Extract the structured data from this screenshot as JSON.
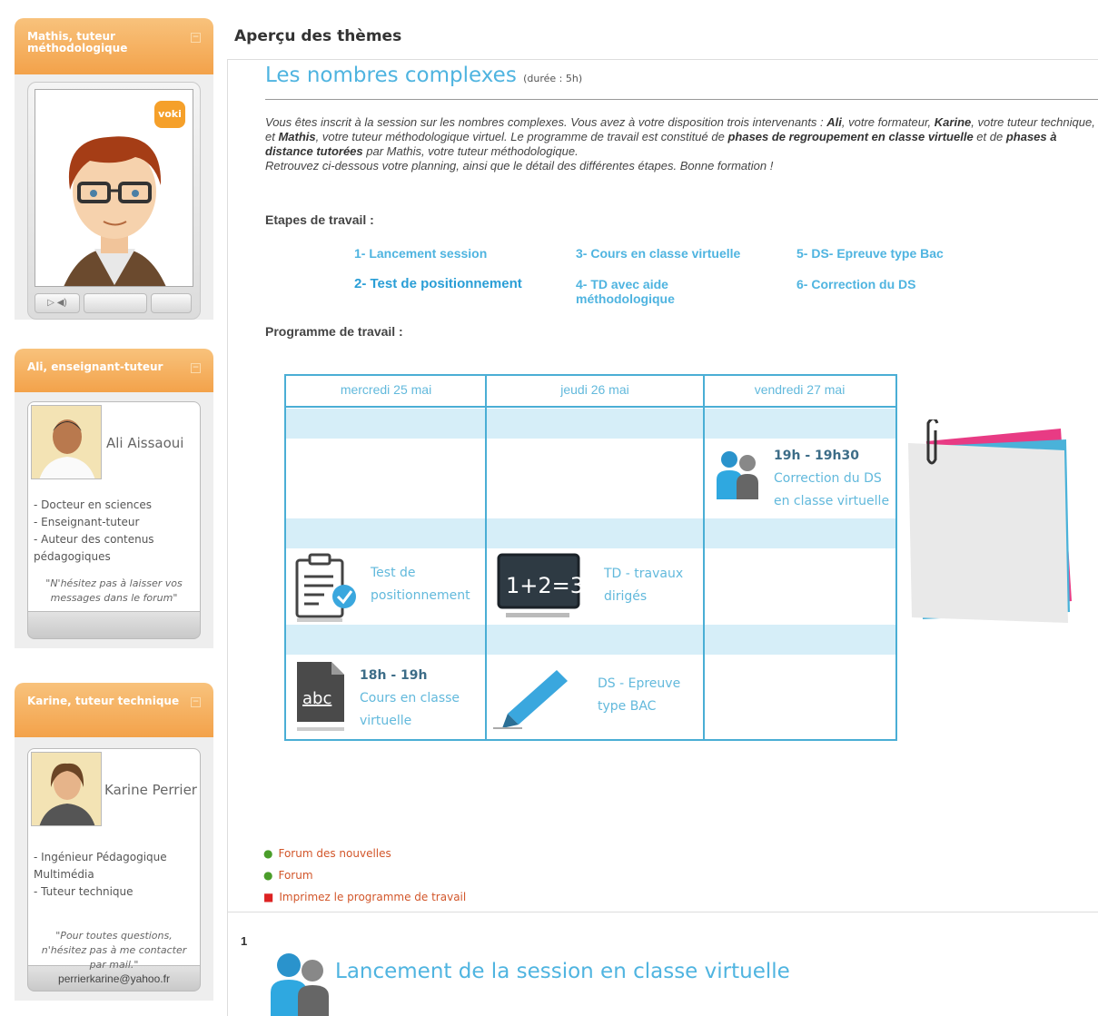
{
  "sidebar": {
    "mathis": {
      "title": "Mathis, tuteur méthodologique",
      "collapse": "−",
      "badge": "voki"
    },
    "ali": {
      "title": "Ali, enseignant-tuteur",
      "collapse": "−",
      "name": "Ali Aissaoui",
      "bullets": [
        "- Docteur en sciences",
        "- Enseignant-tuteur",
        "- Auteur des contenus pédagogiques"
      ],
      "quote": "\"N'hésitez pas à laisser vos messages dans le forum\""
    },
    "karine": {
      "title": "Karine, tuteur technique",
      "collapse": "−",
      "name": "Karine Perrier",
      "bullets": [
        "- Ingénieur Pédagogique Multimédia",
        "- Tuteur technique"
      ],
      "quote": "\"Pour toutes questions, n'hésitez pas à me contacter par mail.\"",
      "email": "perrierkarine@yahoo.fr"
    }
  },
  "main": {
    "title": "Aperçu des thèmes",
    "topic_title": "Les nombres complexes",
    "topic_duration": "(durée : 5h)",
    "intro_1": "Vous êtes inscrit à la session sur les nombres complexes. Vous avez à votre disposition trois intervenants : ",
    "intro_ali": "Ali",
    "intro_2": ", votre formateur, ",
    "intro_karine": "Karine",
    "intro_3": ", votre tuteur technique, et ",
    "intro_mathis": "Mathis",
    "intro_4": ", votre tuteur méthodologique virtuel. Le programme de travail est constitué de ",
    "intro_phases1": "phases de regroupement en classe virtuelle",
    "intro_5": " et de ",
    "intro_phases2": "phases à distance tutorées",
    "intro_6": " par Mathis, votre tuteur méthodologique.",
    "intro_line2": "Retrouvez ci-dessous votre planning, ainsi que le détail des différentes étapes. Bonne formation !",
    "etapes_label": "Etapes de travail :",
    "programme_label": "Programme de travail :",
    "steps": [
      "1- Lancement session",
      "2- Test de positionnement",
      "3- Cours en classe virtuelle",
      "4- TD avec aide méthodologique",
      "5- DS- Epreuve type Bac",
      "6- Correction du DS"
    ],
    "schedule": {
      "days": [
        "mercredi 25 mai",
        "jeudi 26 mai",
        "vendredi 27 mai"
      ],
      "correction_time": "19h - 19h30",
      "correction_text": "Correction du DS en classe virtuelle",
      "test_text": "Test de positionnement",
      "td_text": "TD - travaux dirigés",
      "td_board": "1+2=3",
      "cours_time": "18h - 19h",
      "cours_text": "Cours en classe virtuelle",
      "abc": "abc",
      "ds_text": "DS - Epreuve type BAC"
    },
    "links": [
      "Forum des nouvelles",
      "Forum",
      "Imprimez le programme de travail"
    ],
    "section1_number": "1",
    "section1_title": "Lancement de la session en classe virtuelle"
  }
}
